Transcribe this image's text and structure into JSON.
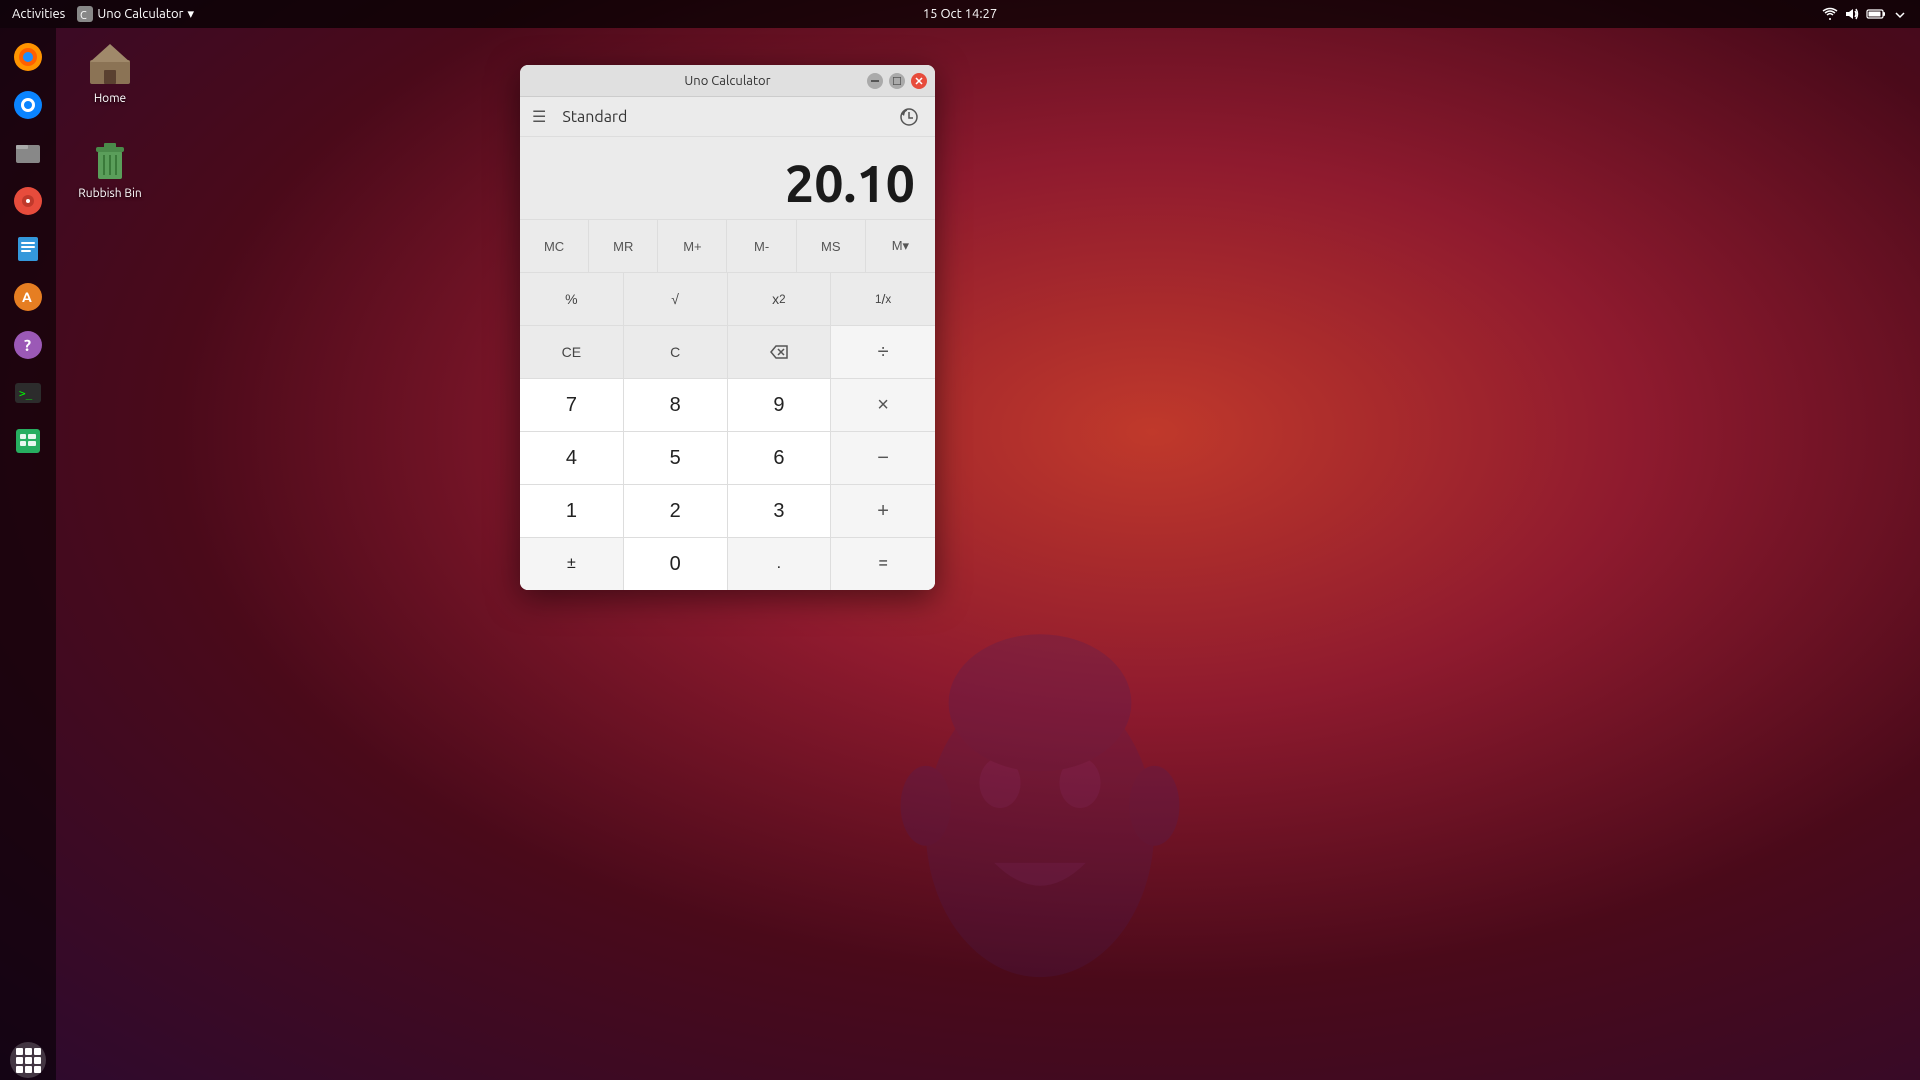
{
  "topbar": {
    "activities": "Activities",
    "app_name": "Uno Calculator",
    "dropdown_arrow": "▾",
    "datetime": "15 Oct  14:27",
    "tray": {
      "network": "network-icon",
      "volume": "volume-icon",
      "battery": "battery-icon",
      "settings": "settings-icon"
    }
  },
  "desktop": {
    "icons": [
      {
        "label": "Home",
        "type": "home"
      },
      {
        "label": "Rubbish Bin",
        "type": "trash"
      }
    ]
  },
  "dock": {
    "items": [
      {
        "name": "firefox",
        "label": "Firefox"
      },
      {
        "name": "thunderbird",
        "label": "Thunderbird"
      },
      {
        "name": "files",
        "label": "Files"
      },
      {
        "name": "rhythmbox",
        "label": "Rhythmbox"
      },
      {
        "name": "libreoffice-writer",
        "label": "LibreOffice Writer"
      },
      {
        "name": "app-store",
        "label": "App Store"
      },
      {
        "name": "help",
        "label": "Help"
      },
      {
        "name": "terminal",
        "label": "Terminal"
      },
      {
        "name": "calc",
        "label": "LibreOffice Calc"
      }
    ]
  },
  "calculator": {
    "title": "Uno Calculator",
    "mode": "Standard",
    "display": "20.10",
    "buttons": {
      "memory_row": [
        "MC",
        "MR",
        "M+",
        "M-",
        "MS",
        "M▾"
      ],
      "row1": [
        "%",
        "√",
        "x²",
        "¹⁄ₓ"
      ],
      "row2": [
        "CE",
        "C",
        "⌫",
        "÷"
      ],
      "row3": [
        "7",
        "8",
        "9",
        "×"
      ],
      "row4": [
        "4",
        "5",
        "6",
        "−"
      ],
      "row5": [
        "1",
        "2",
        "3",
        "+"
      ],
      "row6": [
        "±",
        "0",
        ".",
        "="
      ]
    }
  },
  "show_apps": "show-applications"
}
